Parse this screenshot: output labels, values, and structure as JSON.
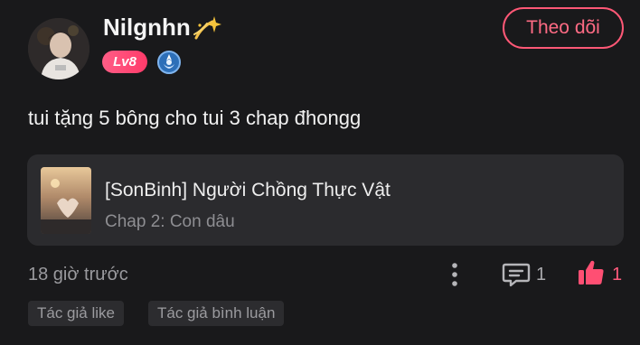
{
  "user": {
    "name": "Nilgnhn",
    "level": "Lv8"
  },
  "follow_label": "Theo dõi",
  "post": {
    "text": "tui tặng 5 bông cho tui 3 chap đhongg"
  },
  "story": {
    "title": "[SonBinh] Người Chồng Thực Vật",
    "chapter": "Chap 2: Con dâu"
  },
  "meta": {
    "time": "18 giờ trước",
    "comment_count": "1",
    "like_count": "1"
  },
  "tags": [
    "Tác giả like",
    "Tác giả bình luận"
  ],
  "colors": {
    "accent": "#ff5876",
    "background": "#19191b",
    "card": "#2b2b2e"
  },
  "icons": {
    "sparkle": "sparkle-icon",
    "rank": "rank-badge-icon",
    "more": "more-vertical-icon",
    "comment": "comment-icon",
    "like": "thumbs-up-icon"
  }
}
